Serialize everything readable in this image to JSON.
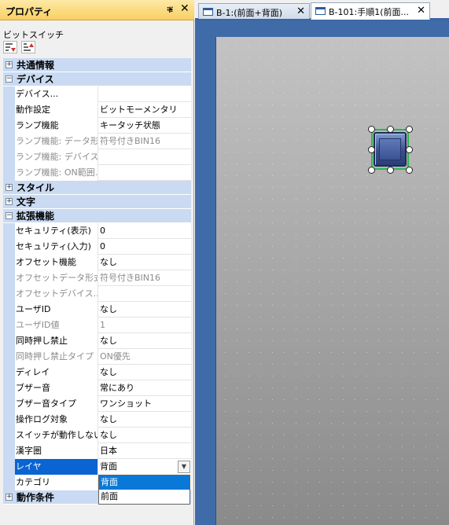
{
  "panel": {
    "title": "プロパティ",
    "pin_glyph": "ቑ",
    "close_glyph": "✕",
    "object_name": "ビットスイッチ"
  },
  "categories": {
    "common": "共通情報",
    "device": "デバイス",
    "style": "スタイル",
    "text": "文字",
    "extended": "拡張機能",
    "operation": "動作条件"
  },
  "device_rows": [
    {
      "name": "デバイス...",
      "value": ""
    },
    {
      "name": "動作設定",
      "value": "ビットモーメンタリ"
    },
    {
      "name": "ランプ機能",
      "value": "キータッチ状態"
    },
    {
      "name": "ランプ機能: データ形式",
      "value": "符号付きBIN16"
    },
    {
      "name": "ランプ機能: デバイス...",
      "value": ""
    },
    {
      "name": "ランプ機能: ON範囲...",
      "value": ""
    }
  ],
  "extended_rows": [
    {
      "name": "セキュリティ(表示)",
      "value": "0"
    },
    {
      "name": "セキュリティ(入力)",
      "value": "0"
    },
    {
      "name": "オフセット機能",
      "value": "なし"
    },
    {
      "name": "オフセットデータ形式",
      "value": "符号付きBIN16"
    },
    {
      "name": "オフセットデバイス...",
      "value": ""
    },
    {
      "name": "ユーザID",
      "value": "なし"
    },
    {
      "name": "ユーザID値",
      "value": "1"
    },
    {
      "name": "同時押し禁止",
      "value": "なし"
    },
    {
      "name": "同時押し禁止タイプ",
      "value": "ON優先"
    },
    {
      "name": "ディレイ",
      "value": "なし"
    },
    {
      "name": "ブザー音",
      "value": "常にあり"
    },
    {
      "name": "ブザー音タイプ",
      "value": "ワンショット"
    },
    {
      "name": "操作ログ対象",
      "value": "なし"
    },
    {
      "name": "スイッチが動作しないとき",
      "value": "なし"
    },
    {
      "name": "漢字圏",
      "value": "日本"
    },
    {
      "name": "レイヤ",
      "value": "背面"
    },
    {
      "name": "カテゴリ",
      "value": ""
    }
  ],
  "layer_dropdown": {
    "options": [
      "背面",
      "前面"
    ],
    "highlighted": "背面"
  },
  "tabs": [
    {
      "label": "B-1:(前面+背面)",
      "close": "✕"
    },
    {
      "label": "B-101:手順1(前面...",
      "close": "✕"
    }
  ],
  "colors": {
    "header_accent": "#f9cf62",
    "category_bg": "#c9daf2",
    "selection": "#0a64d2",
    "workspace": "#3f6ca8",
    "selection_outline": "#2bb64a"
  }
}
